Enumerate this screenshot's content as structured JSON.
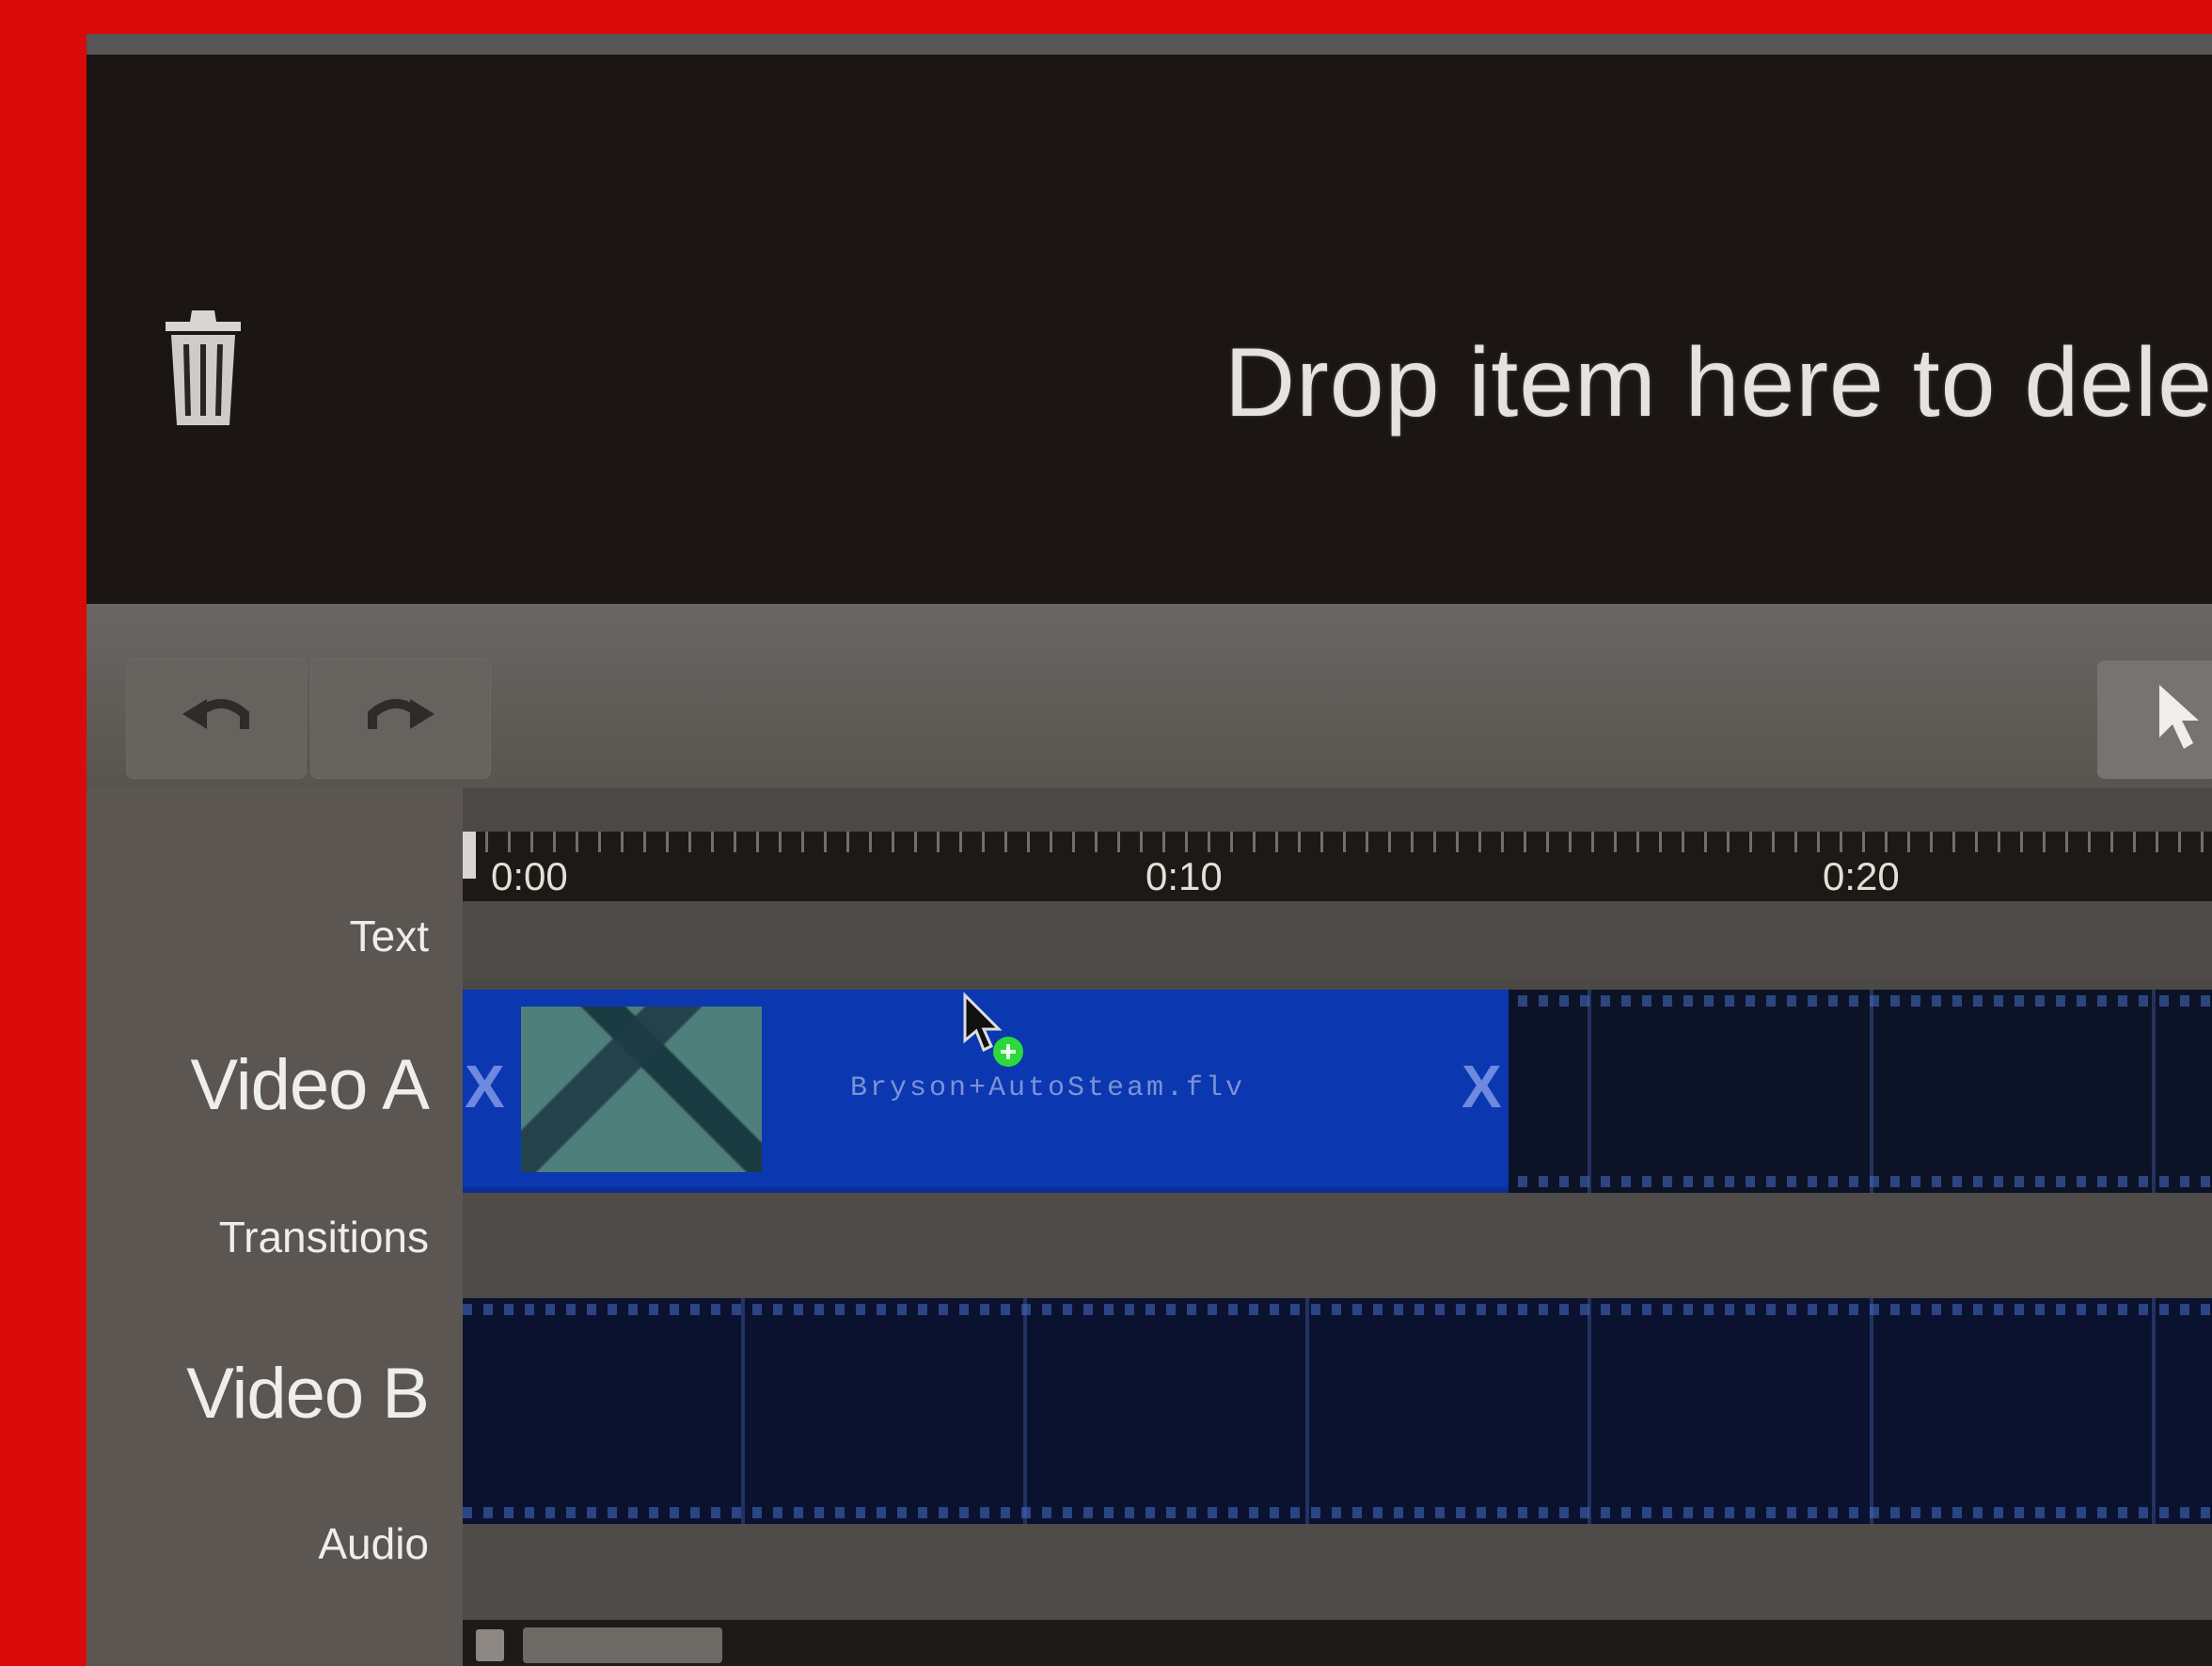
{
  "drop_zone": {
    "icon": "trash-icon",
    "message": "Drop item here to dele"
  },
  "toolbar": {
    "undo_icon": "undo-icon",
    "redo_icon": "redo-icon",
    "right_tool_icon": "cursor-icon"
  },
  "ruler": {
    "ticks": [
      "0:00",
      "0:10",
      "0:20"
    ]
  },
  "tracks": {
    "text": "Text",
    "video_a": "Video A",
    "transitions": "Transitions",
    "video_b": "Video B",
    "audio": "Audio"
  },
  "clip": {
    "name": "Bryson+AutoSteam.flv",
    "remove_glyph": "X",
    "start_glyph": "X"
  },
  "colors": {
    "frame": "#d80a0a",
    "clip": "#0b37b0",
    "lane": "#0c1326"
  }
}
